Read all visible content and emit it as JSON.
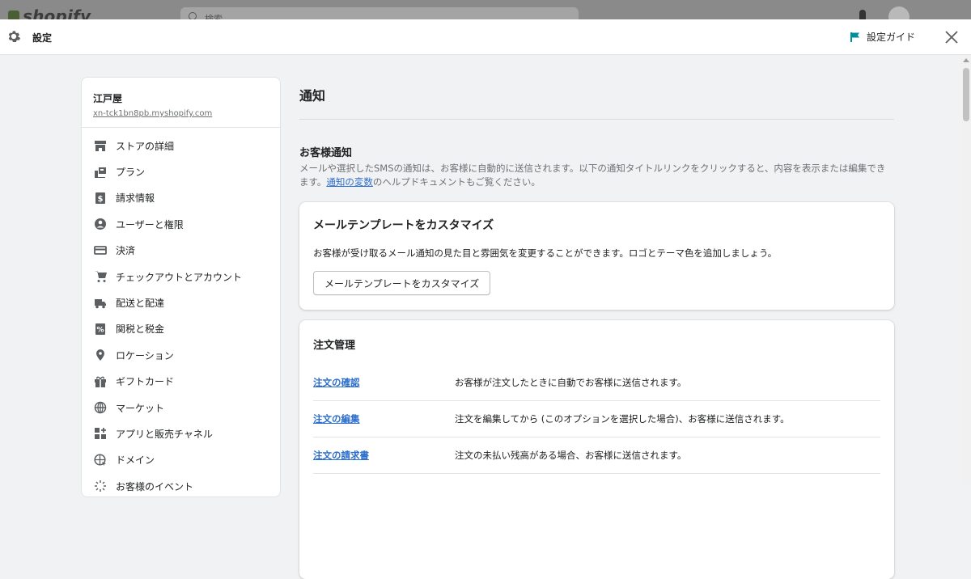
{
  "background": {
    "logo_text": "shopify",
    "search_placeholder": "検索"
  },
  "header": {
    "title": "設定",
    "guide_label": "設定ガイド"
  },
  "store": {
    "name": "江戸屋",
    "domain": "xn-tck1bn8pb.myshopify.com"
  },
  "sidebar": {
    "items": [
      {
        "label": "ストアの詳細",
        "icon": "store-icon"
      },
      {
        "label": "プラン",
        "icon": "plan-icon"
      },
      {
        "label": "請求情報",
        "icon": "billing-icon"
      },
      {
        "label": "ユーザーと権限",
        "icon": "user-icon"
      },
      {
        "label": "決済",
        "icon": "payments-icon"
      },
      {
        "label": "チェックアウトとアカウント",
        "icon": "cart-icon"
      },
      {
        "label": "配送と配達",
        "icon": "truck-icon"
      },
      {
        "label": "関税と税金",
        "icon": "tax-icon"
      },
      {
        "label": "ロケーション",
        "icon": "location-icon"
      },
      {
        "label": "ギフトカード",
        "icon": "gift-icon"
      },
      {
        "label": "マーケット",
        "icon": "globe-icon"
      },
      {
        "label": "アプリと販売チャネル",
        "icon": "apps-icon"
      },
      {
        "label": "ドメイン",
        "icon": "domain-icon"
      },
      {
        "label": "お客様のイベント",
        "icon": "events-icon"
      }
    ]
  },
  "main": {
    "title": "通知",
    "customer_section": {
      "title": "お客様通知",
      "desc_before": "メールや選択したSMSの通知は、お客様に自動的に送信されます。以下の通知タイトルリンクをクリックすると、内容を表示または編集できます。",
      "link": "通知の変数",
      "desc_after": "のヘルプドキュメントもご覧ください。"
    },
    "template_card": {
      "title": "メールテンプレートをカスタマイズ",
      "desc": "お客様が受け取るメール通知の見た目と雰囲気を変更することができます。ロゴとテーマ色を追加しましょう。",
      "button": "メールテンプレートをカスタマイズ"
    },
    "orders_card": {
      "title": "注文管理",
      "rows": [
        {
          "link": "注文の確認",
          "desc": "お客様が注文したときに自動でお客様に送信されます。"
        },
        {
          "link": "注文の編集",
          "desc": "注文を編集してから (このオプションを選択した場合)、お客様に送信されます。"
        },
        {
          "link": "注文の請求書",
          "desc": "注文の未払い残高がある場合、お客様に送信されます。"
        }
      ]
    }
  },
  "colors": {
    "accent_link": "#2c6ecb",
    "guide_flag": "#008e9b",
    "text": "#202223",
    "subdued": "#6d7175"
  }
}
